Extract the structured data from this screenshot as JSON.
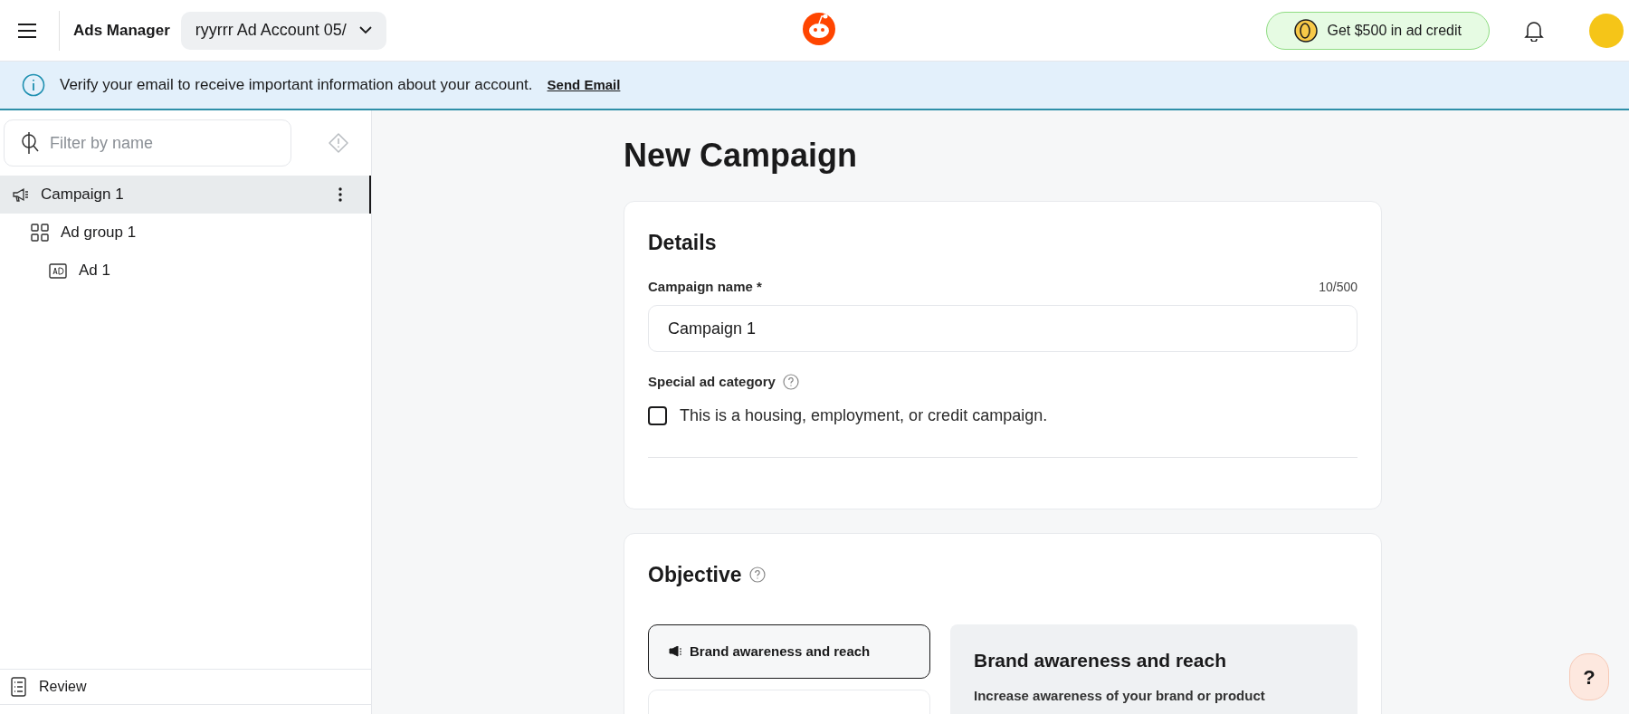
{
  "header": {
    "app_title": "Ads Manager",
    "account": "ryyrrr Ad Account 05/",
    "credit_button": "Get $500 in ad credit"
  },
  "banner": {
    "message": "Verify your email to receive important information about your account.",
    "link": "Send Email"
  },
  "sidebar": {
    "search": {
      "placeholder": "Filter by name"
    },
    "tree": [
      {
        "label": "Campaign 1",
        "kind": "campaign",
        "selected": true,
        "children": [
          {
            "label": "Ad group 1",
            "kind": "adgroup",
            "selected": false,
            "children": [
              {
                "label": "Ad 1",
                "kind": "ad",
                "selected": false
              }
            ]
          }
        ]
      }
    ],
    "footer": "Review"
  },
  "main": {
    "title": "New Campaign",
    "details": {
      "heading": "Details",
      "name_label": "Campaign name *",
      "counter": "10/500",
      "name_value": "Campaign 1",
      "category_label": "Special ad category",
      "checkbox_label": "This is a housing, employment, or credit campaign.",
      "checked": false
    },
    "objective": {
      "heading": "Objective",
      "options": [
        {
          "label": "Brand awareness and reach",
          "selected": true
        },
        {
          "selected": false
        }
      ],
      "panel_title": "Brand awareness and reach",
      "panel_text": "Increase awareness of your brand or product"
    }
  },
  "help_button": "?"
}
